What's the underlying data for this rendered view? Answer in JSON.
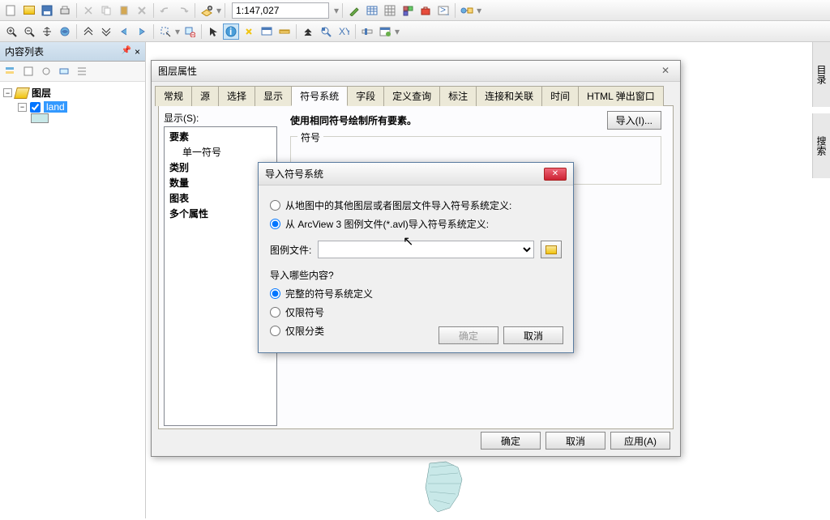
{
  "toolbar1": {
    "scale_value": "1:147,027"
  },
  "toc": {
    "title": "内容列表",
    "root": "图层",
    "layer_name": "land"
  },
  "right_dock": {
    "tab1": "目录",
    "tab2": "搜索"
  },
  "layer_dialog": {
    "title": "图层属性",
    "tabs": [
      "常规",
      "源",
      "选择",
      "显示",
      "符号系统",
      "字段",
      "定义查询",
      "标注",
      "连接和关联",
      "时间",
      "HTML 弹出窗口"
    ],
    "active_tab": 4,
    "show_label": "显示(S):",
    "categories": [
      "要素",
      "单一符号",
      "类别",
      "数量",
      "图表",
      "多个属性"
    ],
    "header_text": "使用相同符号绘制所有要素。",
    "import_btn": "导入(I)...",
    "symbol_group": "符号",
    "ok": "确定",
    "cancel": "取消",
    "apply": "应用(A)"
  },
  "import_dialog": {
    "title": "导入符号系统",
    "opt1": "从地图中的其他图层或者图层文件导入符号系统定义:",
    "opt2": "从 ArcView 3 图例文件(*.avl)导入符号系统定义:",
    "file_label": "图例文件:",
    "file_value": "",
    "section": "导入哪些内容?",
    "sub1": "完整的符号系统定义",
    "sub2": "仅限符号",
    "sub3": "仅限分类",
    "ok": "确定",
    "cancel": "取消"
  }
}
